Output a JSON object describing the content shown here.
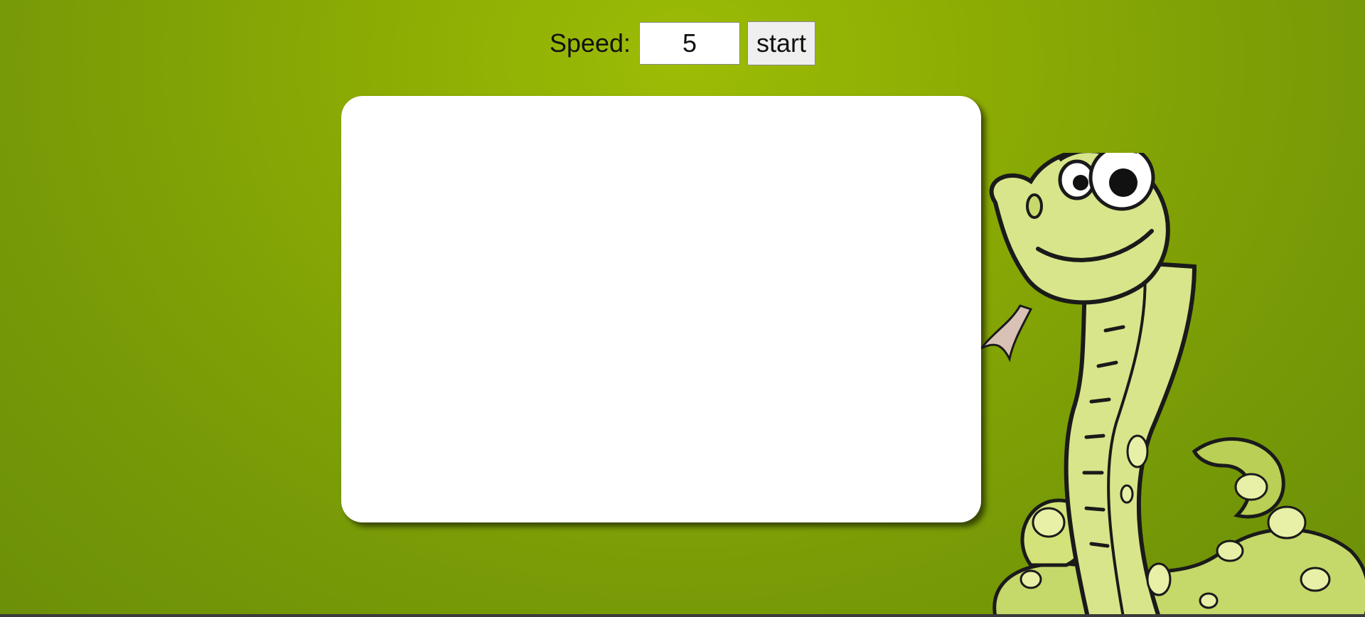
{
  "controls": {
    "speed_label": "Speed:",
    "speed_value": "5",
    "start_label": "start"
  },
  "colors": {
    "background": "#8aaa04",
    "board": "#ffffff",
    "snake_body": "#d4e27a",
    "snake_outline": "#1a1a1a"
  },
  "decoration": {
    "icon": "cartoon-snake-illustration"
  }
}
